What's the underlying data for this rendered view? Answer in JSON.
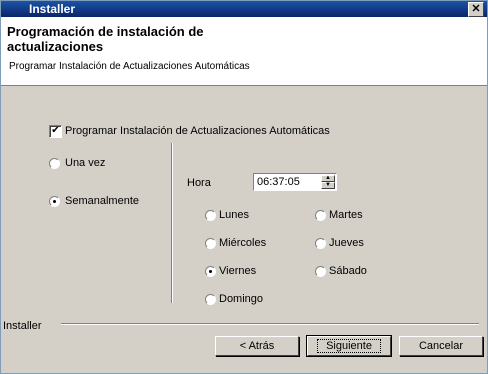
{
  "window": {
    "title": "Installer",
    "close_glyph": "✕"
  },
  "header": {
    "title": "Programación de instalación de actualizaciones",
    "subtitle": "Programar Instalación de Actualizaciones Automáticas"
  },
  "schedule_checkbox": {
    "label": "Programar Instalación de Actualizaciones Automáticas",
    "checked": true
  },
  "frequency": {
    "options": [
      {
        "label": "Una vez",
        "selected": false
      },
      {
        "label": "Semanalmente",
        "selected": true
      }
    ]
  },
  "time": {
    "label": "Hora",
    "value": "06:37:05"
  },
  "days": [
    {
      "label": "Lunes",
      "selected": false
    },
    {
      "label": "Martes",
      "selected": false
    },
    {
      "label": "Miércoles",
      "selected": false
    },
    {
      "label": "Jueves",
      "selected": false
    },
    {
      "label": "Viernes",
      "selected": true
    },
    {
      "label": "Sábado",
      "selected": false
    },
    {
      "label": "Domingo",
      "selected": false
    }
  ],
  "footer": {
    "brand": "Installer",
    "back_label": "< Atrás",
    "next_label": "Siguiente",
    "cancel_label": "Cancelar"
  },
  "colors": {
    "title_bar": "#0a246a",
    "dialog_bg": "#d4d0c8"
  }
}
